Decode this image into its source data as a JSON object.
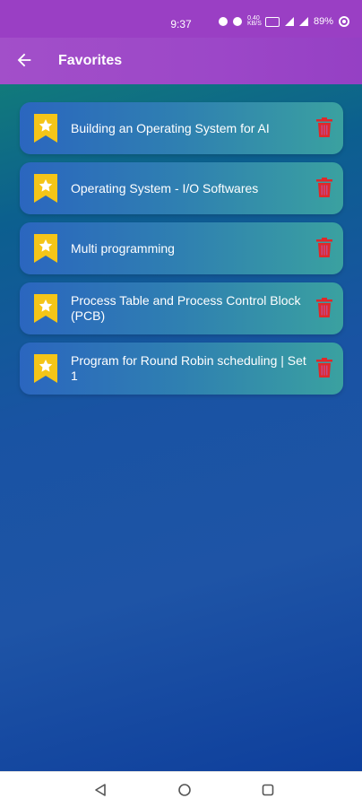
{
  "status_bar": {
    "time": "9:37",
    "net_speed_value": "0.40",
    "net_speed_unit": "KB/S",
    "battery": "89%"
  },
  "app_bar": {
    "title": "Favorites",
    "back_icon": "arrow-left-icon"
  },
  "colors": {
    "app_bar": "#9c47c8",
    "bookmark": "#f5c518",
    "trash": "#e0282a"
  },
  "favorites": [
    {
      "title": "Building an Operating System for AI"
    },
    {
      "title": "Operating System - I/O Softwares"
    },
    {
      "title": "Multi programming"
    },
    {
      "title": "Process Table and Process Control Block (PCB)"
    },
    {
      "title": "Program for Round Robin scheduling | Set 1"
    }
  ],
  "nav": {
    "back": "triangle-back-icon",
    "home": "circle-home-icon",
    "recents": "square-recents-icon"
  }
}
